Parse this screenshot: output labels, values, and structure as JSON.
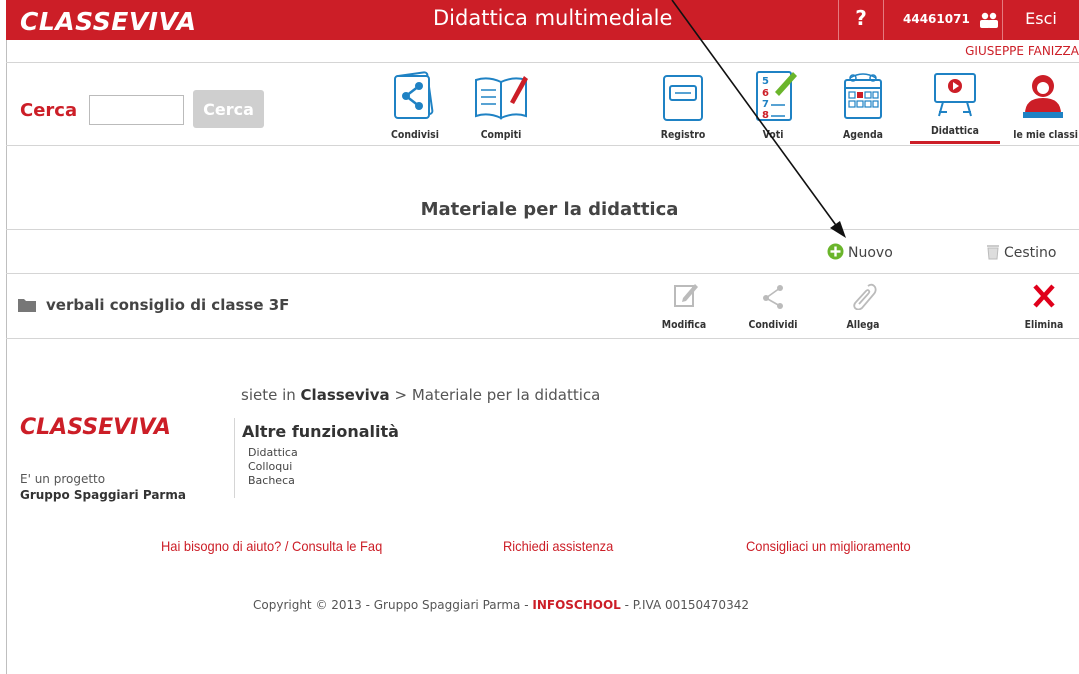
{
  "header": {
    "logo": "CLASSEVIVA",
    "title": "Didattica multimediale",
    "help": "?",
    "user_code": "44461071",
    "logout": "Esci",
    "username": "GIUSEPPE FANIZZA"
  },
  "search": {
    "label": "Cerca",
    "input_value": "",
    "button": "Cerca"
  },
  "nav": {
    "items": [
      {
        "label": "Condivisi",
        "icon": "share-icon"
      },
      {
        "label": "Compiti",
        "icon": "book-icon"
      },
      {
        "label": "Registro",
        "icon": "register-icon"
      },
      {
        "label": "Voti",
        "icon": "grades-icon"
      },
      {
        "label": "Agenda",
        "icon": "calendar-icon"
      },
      {
        "label": "Didattica",
        "icon": "presentation-icon",
        "active": true
      },
      {
        "label": "le mie classi",
        "icon": "teacher-icon"
      }
    ]
  },
  "main": {
    "title": "Materiale per la didattica",
    "actions": {
      "new": "Nuovo",
      "trash": "Cestino"
    },
    "folders": [
      {
        "name": "verbali consiglio di classe 3F",
        "actions": {
          "edit": "Modifica",
          "share": "Condividi",
          "attach": "Allega",
          "delete": "Elimina"
        }
      }
    ]
  },
  "footer": {
    "breadcrumb_prefix": "siete in",
    "breadcrumb_home": "Classeviva",
    "breadcrumb_sep": ">",
    "breadcrumb_current": "Materiale per la didattica",
    "logo": "CLASSEVIVA",
    "project_line1": "E' un progetto",
    "project_line2": "Gruppo Spaggiari Parma",
    "other_title": "Altre funzionalità",
    "other_links": [
      "Didattica",
      "Colloqui",
      "Bacheca"
    ],
    "help_links": [
      "Hai bisogno di aiuto? / Consulta le Faq",
      "Richiedi assistenza",
      "Consigliaci un miglioramento"
    ],
    "copyright_pre": "Copyright © 2013 - Gruppo Spaggiari Parma -",
    "copyright_brand": "INFOSCHOOL",
    "copyright_post": "- P.IVA 00150470342"
  },
  "colors": {
    "brand_red": "#cc1e27",
    "green": "#6ab52b"
  }
}
